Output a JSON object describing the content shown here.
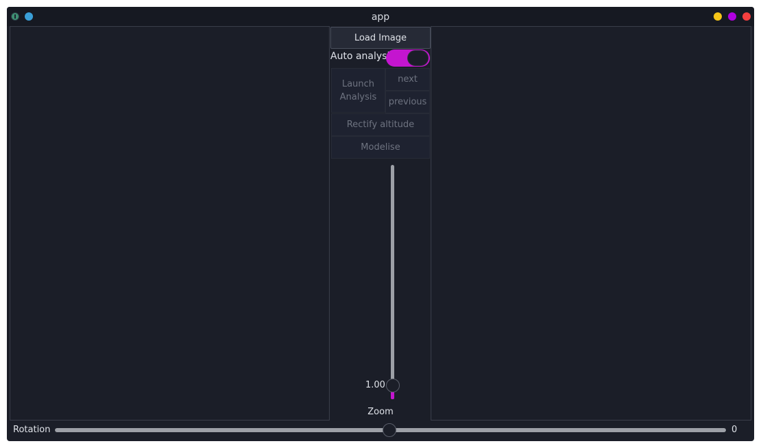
{
  "window": {
    "title": "app"
  },
  "controls": {
    "load_image": "Load Image",
    "auto_analysis_label": "Auto analysis",
    "auto_analysis_on": true,
    "launch_analysis": "Launch Analysis",
    "next": "next",
    "previous": "previous",
    "rectify_altitude": "Rectify altitude",
    "modelise": "Modelise"
  },
  "zoom": {
    "value": "1.00",
    "label": "Zoom",
    "level_fraction": 0.0
  },
  "rotation": {
    "label": "Rotation",
    "value": "0"
  },
  "colors": {
    "accent": "#c415cf",
    "background": "#1b1e28",
    "minimize": "#f5c518",
    "maximize": "#b000e0",
    "close": "#f43f3f"
  },
  "icons": {
    "app": "app-icon",
    "pin": "pin-icon",
    "minimize": "minimize-icon",
    "maximize": "maximize-icon",
    "close": "close-icon"
  }
}
